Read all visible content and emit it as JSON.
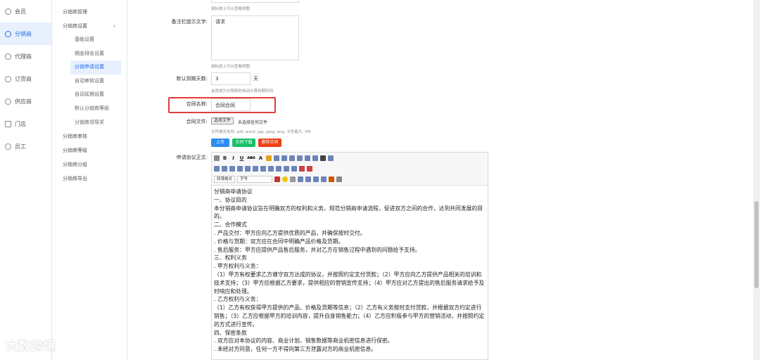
{
  "nav_primary": [
    {
      "label": "会员",
      "active": false
    },
    {
      "label": "分销商",
      "active": true
    },
    {
      "label": "代理商",
      "active": false
    },
    {
      "label": "订货商",
      "active": false
    },
    {
      "label": "供应商",
      "active": false
    },
    {
      "label": "门店",
      "active": false
    },
    {
      "label": "员工",
      "active": false
    }
  ],
  "nav_secondary": {
    "manage": "分销商管理",
    "settings_group": "分销商设置",
    "settings_arrow": "›",
    "settings_items": [
      "基础设置",
      "佣金排名设置",
      "分销申请设置",
      "自动审核设置",
      "自动延期设置",
      "默认分销商等级",
      "分销商领导奖"
    ],
    "active_index": 2,
    "rest": [
      "分销商审核",
      "分销商等级",
      "分销商分组",
      "分销商导出"
    ]
  },
  "form": {
    "top_hint": "鼠标放上可以查看例图",
    "remark_label": "备注栏提示文字:",
    "remark_value": "请求",
    "remark_hint": "鼠标放上可以查看例图",
    "expire_label": "默认到期天数:",
    "expire_value": "3",
    "expire_unit": "天",
    "expire_hint": "会员成为分销商时自动计算到期时间",
    "contract_name_label": "合同名称:",
    "contract_name_value": "合同合同",
    "contract_file_label": "合同文件:",
    "choose_file": "选择文件",
    "no_file": "未选择任何文件",
    "file_hint": "文件格式支持: pdf, word, jpg, jpeg, png, 文件最大: 5M",
    "btn_upload": "上传",
    "btn_download": "合同下载",
    "btn_delete": "删除合同",
    "agreement_label": "申请协议正文:"
  },
  "editor": {
    "paragraph_select": "段落格式",
    "font_size_select": "字号",
    "toolbar_text": [
      "B",
      "I",
      "U",
      "ABC",
      "A"
    ],
    "lines": [
      "分销商申请协议",
      "一、协议目的",
      "本分销商申请协议旨在明确双方的权利和义务，规范分销商申请流程，促进双方之间的合作，达到共同发展的目的。",
      "二、合作模式",
      ". 产品交付：甲方应向乙方提供优质的产品，并确保按时交付。",
      ". 价格与货期：双方应在合同中明确产品价格及货期。",
      ". 售后服务：甲方应提供产品售后服务，并对乙方在销售过程中遇到的问题给予支持。",
      "三、权利义务",
      ". 甲方权利与义务：",
      "（1）甲方有权要求乙方遵守双方达成的协议，并按照约定支付货款；（2）甲方应向乙方提供产品相关的培训和技术支持；（3）甲方应根据乙方要求，提供相应的营销宣传支持；（4）甲方应对乙方提出的售后服务请求给予及时响应和处理。",
      ". 乙方权利与义务：",
      "（1）乙方有权获得甲方提供的产品、价格及货期等信息；（2）乙方有义务按时支付货款，并根据双方约定进行销售；（3）乙方应根据甲方的培训内容，提升自身销售能力；（4）乙方应积极参与甲方的营销活动，并按照约定的方式进行宣传。",
      "四、保密条款",
      ". 双方应对本协议的内容、商业计划、销售数据等商业机密信息进行保密。",
      ". 未经对方同意，任何一方不得向第三方泄露对方的商业机密信息。"
    ]
  },
  "watermark": "大数跨境"
}
